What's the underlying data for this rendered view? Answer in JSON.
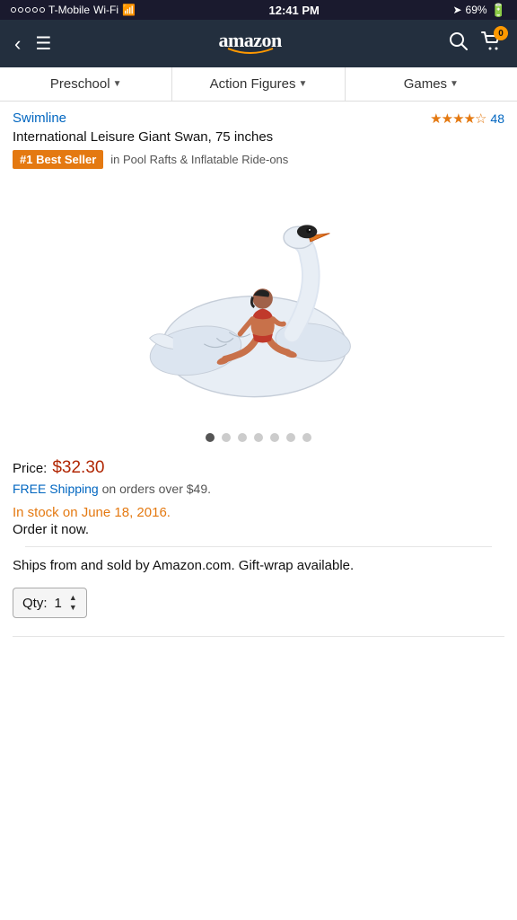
{
  "statusBar": {
    "carrier": "T-Mobile",
    "network": "Wi-Fi",
    "time": "12:41 PM",
    "battery": "69%",
    "signal_dots": [
      false,
      false,
      false,
      false,
      false
    ]
  },
  "header": {
    "back_label": "‹",
    "menu_label": "≡",
    "logo": "amazon",
    "logo_smile": "smile",
    "search_label": "🔍",
    "cart_label": "🛒",
    "cart_count": "0"
  },
  "navTabs": [
    {
      "label": "Preschool",
      "id": "preschool"
    },
    {
      "label": "Action Figures",
      "id": "action-figures"
    },
    {
      "label": "Games",
      "id": "games"
    }
  ],
  "product": {
    "brand": "Swimline",
    "title": "International Leisure Giant Swan, 75 inches",
    "rating_stars": "★★★★☆",
    "rating_count": "48",
    "best_seller_badge": "#1 Best Seller",
    "best_seller_category": "in Pool Rafts & Inflatable Ride-ons",
    "price_label": "Price:",
    "price": "$32.30",
    "shipping_text": "FREE Shipping",
    "shipping_suffix": " on orders over $49.",
    "stock_status": "In stock on June 18, 2016.",
    "order_now": "Order it now.",
    "ships_from": "Ships from and sold by Amazon.com. Gift-wrap available.",
    "qty_label": "Qty:",
    "qty_value": "1",
    "carousel_dots": [
      true,
      false,
      false,
      false,
      false,
      false,
      false
    ]
  }
}
